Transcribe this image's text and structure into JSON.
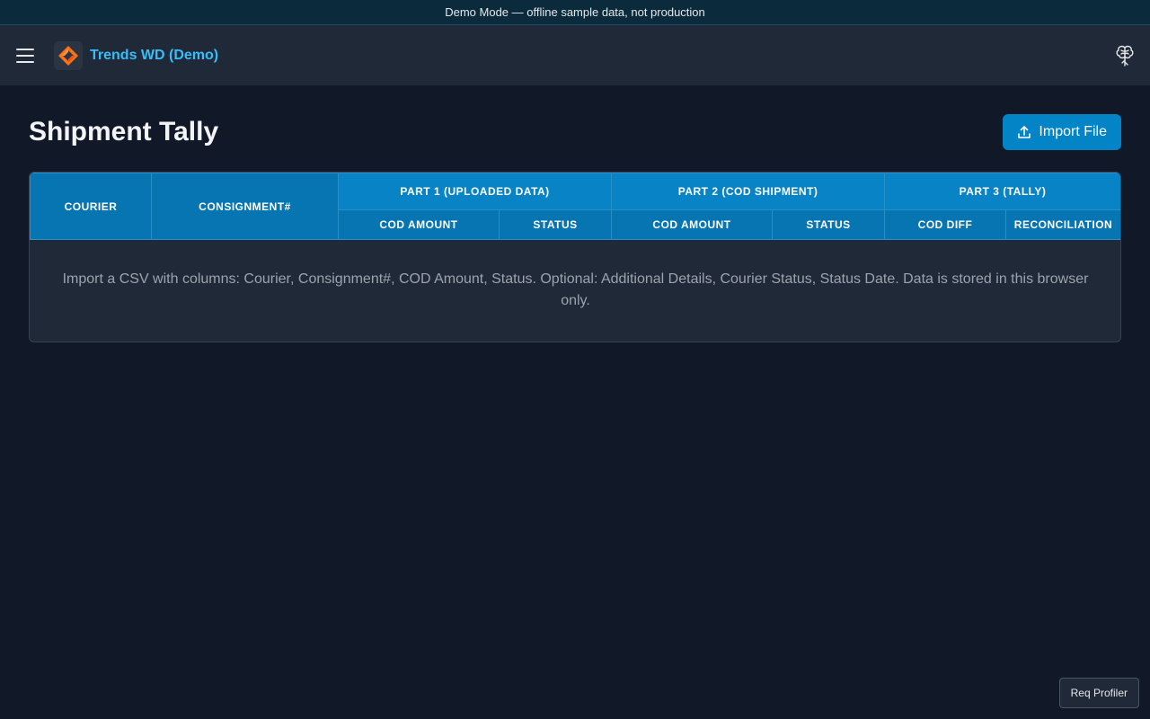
{
  "banner": {
    "text": "Demo Mode — offline sample data, not production"
  },
  "topbar": {
    "app_title": "Trends WD (Demo)",
    "menu_icon": "hamburger-menu-icon",
    "logo_icon": "app-logo-icon",
    "right_icon": "brain-icon"
  },
  "page": {
    "title": "Shipment Tally",
    "import_button": "Import File",
    "import_icon": "upload-icon"
  },
  "table": {
    "headers": {
      "courier": "Courier",
      "consignment": "Consignment#",
      "part1": "Part 1 (Uploaded Data)",
      "part2": "Part 2 (COD Shipment)",
      "part3": "Part 3 (Tally)",
      "p1_cod_amount": "COD Amount",
      "p1_status": "Status",
      "p2_cod_amount": "COD Amount",
      "p2_status": "Status",
      "p3_cod_diff": "COD Diff",
      "p3_reconciliation": "Reconciliation"
    },
    "empty_message": "Import a CSV with columns: Courier, Consignment#, COD Amount, Status. Optional: Additional Details, Courier Status, Status Date. Data is stored in this browser only."
  },
  "profiler": {
    "label": "Req Profiler"
  },
  "colors": {
    "accent": "#0284c7",
    "title_accent": "#38bdf8",
    "background": "#111827",
    "header_blue": "#0675b2"
  }
}
